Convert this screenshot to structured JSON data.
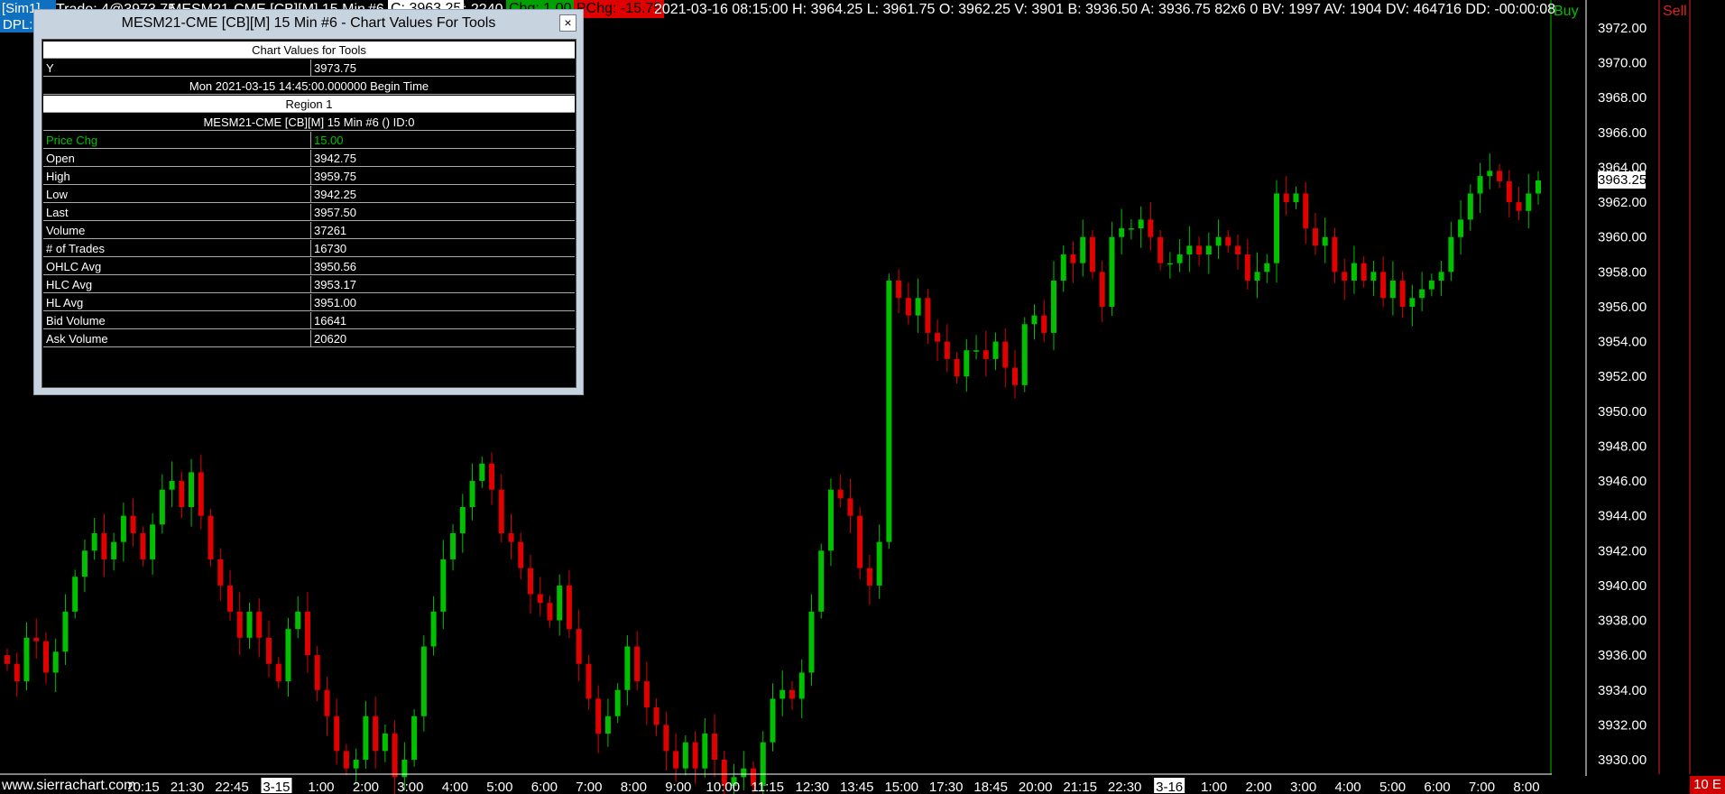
{
  "header": {
    "sim_tab": "[Sim1]",
    "dpl_tab": "DPL:",
    "trade_text": "Trade: 4@3973.75",
    "symbol_text": "MESM21-CME [CB][M]  15 Min",
    "chart_num": "#6",
    "c_value": "C: 3963.25",
    "t_value": "T: 2240",
    "chg_value": "Chg: 1.00",
    "pchg_value": "PChg: -15.75",
    "info_line": "2021-03-16 08:15:00 H: 3964.25 L: 3961.75 O: 3962.25 V: 3901 B: 3936.50 A: 3936.75 82x6 0 BV: 1997 AV: 1904 DV: 464716 DD: -00:00:08",
    "buy_label": "Buy",
    "sell_label": "Sell",
    "colors": {
      "tab_blue": "#1070c0",
      "chg_green": "#00a000",
      "pchg_red": "#e00000"
    }
  },
  "tool_window": {
    "title": "MESM21-CME [CB][M]  15 Min   #6 - Chart Values For Tools",
    "close_label": "×",
    "heading": "Chart Values for Tools",
    "y_label": "Y",
    "y_value": "3973.75",
    "begin_time": "Mon 2021-03-15  14:45:00.000000 Begin Time",
    "region": "Region 1",
    "study_line": "MESM21-CME [CB][M]  15 Min   #6 ()   ID:0",
    "rows": [
      {
        "label": "Price Chg",
        "value": "15.00"
      },
      {
        "label": "Open",
        "value": "3942.75"
      },
      {
        "label": "High",
        "value": "3959.75"
      },
      {
        "label": "Low",
        "value": "3942.25"
      },
      {
        "label": "Last",
        "value": "3957.50"
      },
      {
        "label": "Volume",
        "value": "37261"
      },
      {
        "label": "# of Trades",
        "value": "16730"
      },
      {
        "label": "OHLC Avg",
        "value": "3950.56"
      },
      {
        "label": "HLC Avg",
        "value": "3953.17"
      },
      {
        "label": "HL Avg",
        "value": "3951.00"
      },
      {
        "label": "Bid Volume",
        "value": "16641"
      },
      {
        "label": "Ask Volume",
        "value": "20620"
      }
    ]
  },
  "price_tag": "3963.25",
  "corner_tag": "10 E",
  "watermark": "www.sierrachart.com",
  "chart_data": {
    "type": "candlestick",
    "y_ticks": [
      "3972.00",
      "3970.00",
      "3968.00",
      "3966.00",
      "3964.00",
      "3962.00",
      "3960.00",
      "3958.00",
      "3956.00",
      "3954.00",
      "3952.00",
      "3950.00",
      "3948.00",
      "3946.00",
      "3944.00",
      "3942.00",
      "3940.00",
      "3938.00",
      "3936.00",
      "3934.00",
      "3932.00",
      "3930.00"
    ],
    "x_ticks": [
      "20:15",
      "21:30",
      "22:45",
      "3-15",
      "1:00",
      "2:00",
      "3:00",
      "4:00",
      "5:00",
      "6:00",
      "7:00",
      "8:00",
      "9:00",
      "10:00",
      "11:15",
      "12:30",
      "13:45",
      "15:00",
      "17:30",
      "18:45",
      "20:00",
      "21:15",
      "22:30",
      "3-16",
      "1:00",
      "2:00",
      "3:00",
      "4:00",
      "5:00",
      "6:00",
      "7:00",
      "8:00"
    ],
    "highlighted_x_ticks": [
      "3-15",
      "3-16"
    ],
    "up_color": "#00c000",
    "down_color": "#e00000",
    "closes": [
      3935.5,
      3934.5,
      3937.0,
      3936.8,
      3935.0,
      3936.2,
      3938.5,
      3940.5,
      3942.0,
      3943.0,
      3941.5,
      3942.5,
      3944.0,
      3943.0,
      3941.5,
      3943.5,
      3945.5,
      3946.0,
      3944.5,
      3946.5,
      3944.0,
      3941.5,
      3940.0,
      3938.5,
      3937.0,
      3938.5,
      3937.0,
      3935.5,
      3934.5,
      3937.5,
      3938.5,
      3936.0,
      3934.0,
      3932.5,
      3930.5,
      3929.5,
      3930.0,
      3932.5,
      3930.5,
      3931.5,
      3929.0,
      3930.0,
      3932.5,
      3936.5,
      3938.5,
      3941.5,
      3943.0,
      3944.5,
      3946.0,
      3947.0,
      3945.5,
      3943.0,
      3942.5,
      3941.0,
      3939.5,
      3939.0,
      3938.0,
      3940.0,
      3937.5,
      3935.5,
      3933.5,
      3931.5,
      3932.5,
      3934.0,
      3936.5,
      3934.5,
      3933.0,
      3932.0,
      3930.5,
      3929.5,
      3931.0,
      3929.5,
      3931.5,
      3930.0,
      3928.5,
      3929.0,
      3929.5,
      3928.5,
      3931.0,
      3933.5,
      3934.0,
      3933.5,
      3935.0,
      3938.5,
      3942.0,
      3945.5,
      3945.0,
      3944.0,
      3941.0,
      3940.0,
      3942.5,
      3957.5,
      3956.5,
      3955.5,
      3956.5,
      3954.5,
      3954.0,
      3953.0,
      3952.0,
      3953.5,
      3953.5,
      3953.0,
      3954.0,
      3952.5,
      3951.5,
      3955.0,
      3955.5,
      3954.5,
      3957.5,
      3959.0,
      3958.5,
      3960.0,
      3958.0,
      3956.0,
      3960.0,
      3960.5,
      3960.5,
      3961.0,
      3960.0,
      3958.5,
      3958.5,
      3959.0,
      3959.5,
      3959.0,
      3959.5,
      3960.0,
      3959.5,
      3959.0,
      3957.5,
      3958.0,
      3958.5,
      3962.5,
      3962.0,
      3962.5,
      3960.5,
      3959.5,
      3960.0,
      3958.0,
      3957.5,
      3958.5,
      3957.5,
      3958.0,
      3956.5,
      3957.5,
      3956.0,
      3956.5,
      3957.0,
      3957.5,
      3958.0,
      3960.0,
      3961.0,
      3962.5,
      3963.5,
      3963.8,
      3963.2,
      3962.0,
      3961.5,
      3962.5,
      3963.25
    ]
  }
}
